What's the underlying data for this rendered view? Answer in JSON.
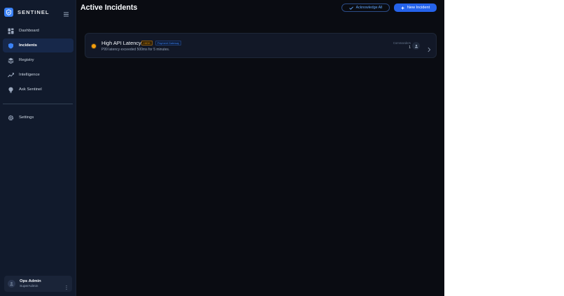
{
  "brand": {
    "name": "SENTINEL"
  },
  "sidebar": {
    "items": [
      {
        "label": "Dashboard",
        "icon": "dashboard-icon",
        "active": false
      },
      {
        "label": "Incidents",
        "icon": "shield-icon",
        "active": true
      },
      {
        "label": "Registry",
        "icon": "layers-icon",
        "active": false
      },
      {
        "label": "Intelligence",
        "icon": "trend-icon",
        "active": false
      },
      {
        "label": "Ask Sentinel",
        "icon": "bulb-icon",
        "active": false
      }
    ],
    "secondary": [
      {
        "label": "Settings",
        "icon": "gear-icon"
      }
    ]
  },
  "user": {
    "name": "Ops Admin",
    "role": "SuperAdmin"
  },
  "header": {
    "title": "Active Incidents",
    "acknowledge_label": "Acknowledge All",
    "new_label": "New Incident"
  },
  "incidents": [
    {
      "title": "High API Latency",
      "severity": "HIGH",
      "service": "Payment Gateway",
      "description": "P99 latency exceeded 500ms for 5 minutes.",
      "commanders_label": "Commanders",
      "commanders_count": "1"
    }
  ],
  "colors": {
    "accent": "#2563eb",
    "sidebar_bg": "#111a2c",
    "main_bg": "#0a0c12",
    "severity_high": "#f59e0b"
  }
}
